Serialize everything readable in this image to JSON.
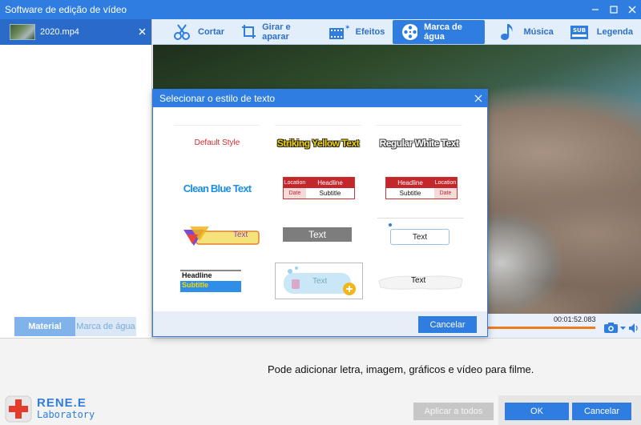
{
  "window": {
    "title": "Software de edição de vídeo"
  },
  "file": {
    "name": "2020.mp4"
  },
  "toolbar": {
    "items": [
      {
        "label": "Cortar",
        "icon": "scissors-icon"
      },
      {
        "label": "Girar e aparar",
        "icon": "crop-rotate-icon"
      },
      {
        "label": "Efeitos",
        "icon": "film-effects-icon"
      },
      {
        "label": "Marca de água",
        "icon": "film-reel-icon"
      },
      {
        "label": "Música",
        "icon": "music-note-icon"
      },
      {
        "label": "Legenda",
        "icon": "subtitle-icon"
      }
    ],
    "active_index": 3
  },
  "sidebar": {
    "tabs": [
      "Material",
      "Marca de água"
    ]
  },
  "player": {
    "timecode": "00:01:52.083"
  },
  "bottom": {
    "hint": "Pode adicionar letra, imagem, gráficos e vídeo para filme.",
    "apply_all": "Aplicar a todos",
    "ok": "OK",
    "cancel": "Cancelar"
  },
  "logo": {
    "line1": "RENE.E",
    "line2": "Laboratory"
  },
  "dialog": {
    "title": "Selecionar o estilo de texto",
    "cancel": "Cancelar",
    "styles": {
      "default": "Default Style",
      "yellow": "Striking Yellow Text",
      "white": "Regular White Text",
      "blue": "Clean Blue Text",
      "location": "Location",
      "headline": "Headline",
      "date": "Date",
      "subtitle": "Subtitle",
      "text": "Text"
    }
  },
  "colors": {
    "accent": "#2f7de0",
    "progress": "#f07b1d"
  }
}
